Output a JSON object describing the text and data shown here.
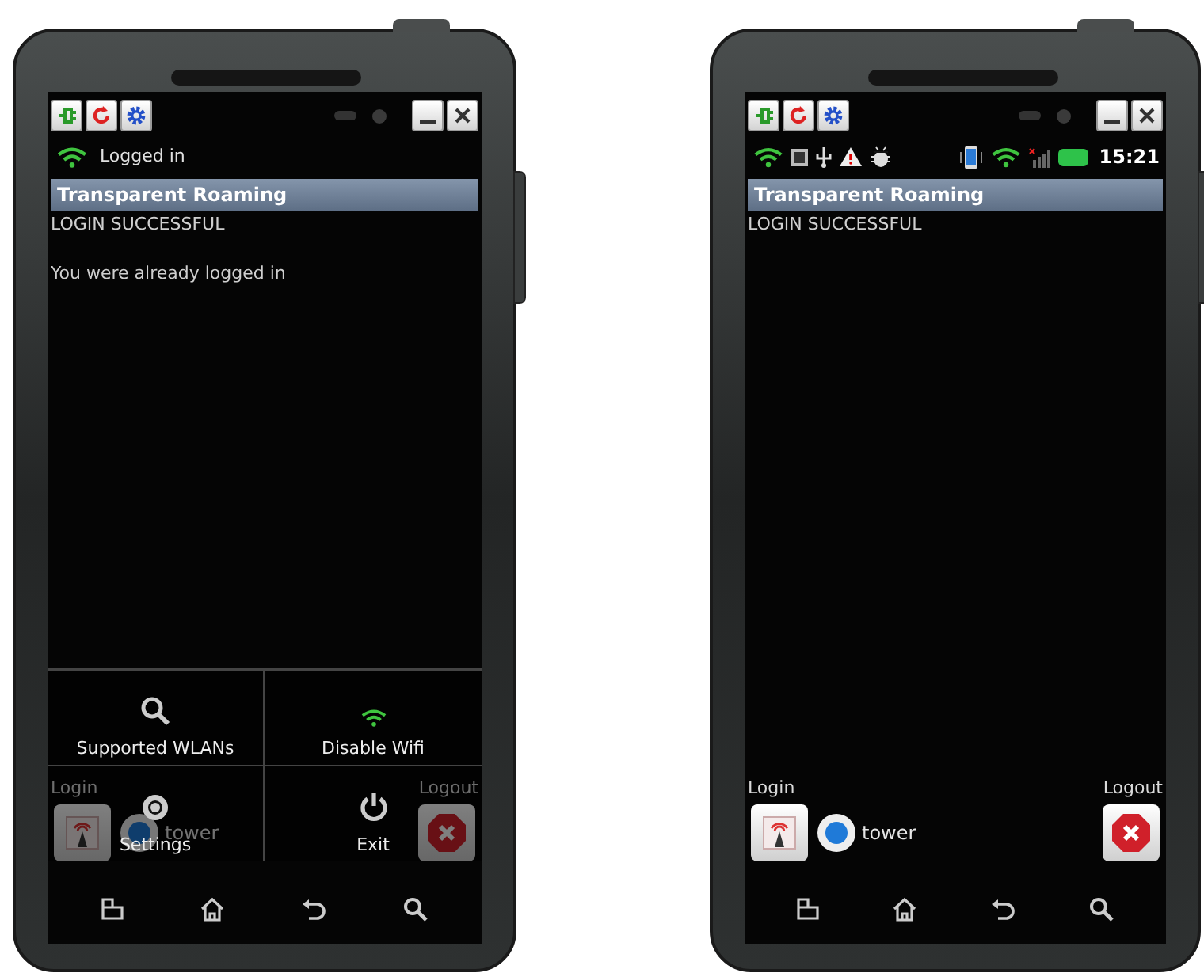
{
  "phones": [
    {
      "status": {
        "kind": "login",
        "text": "Logged in"
      },
      "title": "Transparent Roaming",
      "message": "LOGIN SUCCESSFUL",
      "detail": "You were already logged in",
      "login_label": "Login",
      "logout_label": "Logout",
      "network": {
        "name": "tower",
        "selected": true
      },
      "menu": {
        "items": [
          {
            "label": "Supported WLANs",
            "kind": "search"
          },
          {
            "label": "Disable Wifi",
            "kind": "wifi"
          },
          {
            "label": "Settings",
            "kind": "settings"
          },
          {
            "label": "Exit",
            "kind": "exit"
          }
        ]
      }
    },
    {
      "status": {
        "kind": "system",
        "time": "15:21"
      },
      "title": "Transparent Roaming",
      "message": "LOGIN SUCCESSFUL",
      "login_label": "Login",
      "logout_label": "Logout",
      "network": {
        "name": "tower",
        "selected": true
      }
    }
  ]
}
